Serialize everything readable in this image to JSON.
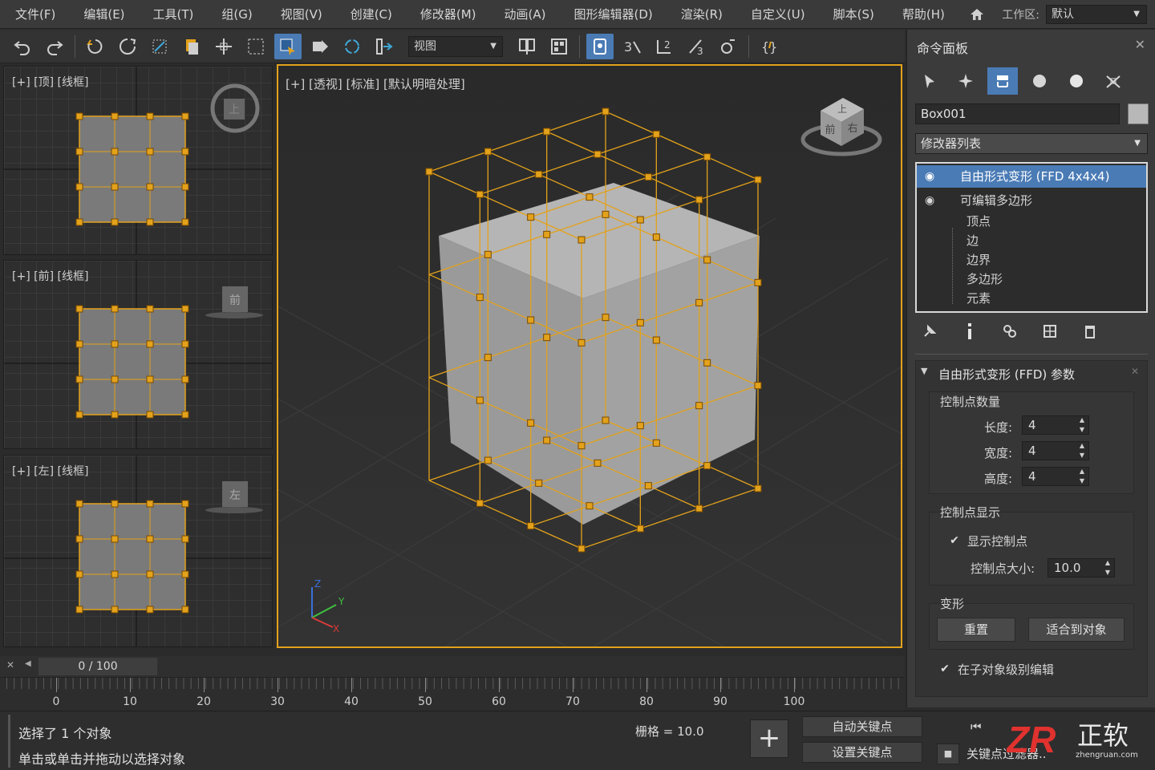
{
  "menubar": {
    "items": [
      "文件(F)",
      "编辑(E)",
      "工具(T)",
      "组(G)",
      "视图(V)",
      "创建(C)",
      "修改器(M)",
      "动画(A)",
      "图形编辑器(D)",
      "渲染(R)",
      "自定义(U)",
      "脚本(S)",
      "帮助(H)"
    ],
    "workspace_label": "工作区:",
    "workspace_value": "默认"
  },
  "toolbar": {
    "view_dropdown": "视图"
  },
  "viewports": {
    "top": {
      "label": "[+] [顶] [线框]",
      "cube": "上"
    },
    "front": {
      "label": "[+] [前] [线框]",
      "cube": "前"
    },
    "left": {
      "label": "[+] [左] [线框]",
      "cube": "左"
    },
    "perspective": {
      "label": "[+] [透视] [标准] [默认明暗处理]",
      "cube_top": "上",
      "cube_front": "前",
      "cube_right": "右"
    }
  },
  "axis": {
    "z": "Z",
    "y": "Y",
    "x": "X"
  },
  "command_panel": {
    "title": "命令面板",
    "object_name": "Box001",
    "modifier_list": "修改器列表",
    "stack": {
      "ffd": "自由形式变形 (FFD 4x4x4)",
      "epoly": "可编辑多边形",
      "subs": [
        "顶点",
        "边",
        "边界",
        "多边形",
        "元素"
      ]
    },
    "rollout": {
      "title": "自由形式变形 (FFD) 参数",
      "group_count": "控制点数量",
      "length_label": "长度:",
      "length_value": "4",
      "width_label": "宽度:",
      "width_value": "4",
      "height_label": "高度:",
      "height_value": "4",
      "group_display": "控制点显示",
      "show_points": "显示控制点",
      "point_size_label": "控制点大小:",
      "point_size_value": "10.0",
      "group_deform": "变形",
      "reset": "重置",
      "fit": "适合到对象",
      "sub_edit": "在子对象级别编辑"
    }
  },
  "timeline": {
    "frame": "0 / 100",
    "ruler_labels": [
      "0",
      "10",
      "20",
      "30",
      "40",
      "50",
      "60",
      "70",
      "80",
      "90",
      "100"
    ]
  },
  "status": {
    "msg1": "选择了 1 个对象",
    "msg2": "单击或单击并拖动以选择对象",
    "grid": "栅格 = 10.0",
    "auto_key": "自动关键点",
    "set_key": "设置关键点",
    "key_filter": "关键点过滤器..."
  },
  "watermark": {
    "brand_letters": "ZR",
    "brand_cn": "正软",
    "url": "zhengruan.com"
  },
  "colors": {
    "accent": "#4a7bb5",
    "lattice": "#e3a21b",
    "box": "#a8a8a8"
  }
}
